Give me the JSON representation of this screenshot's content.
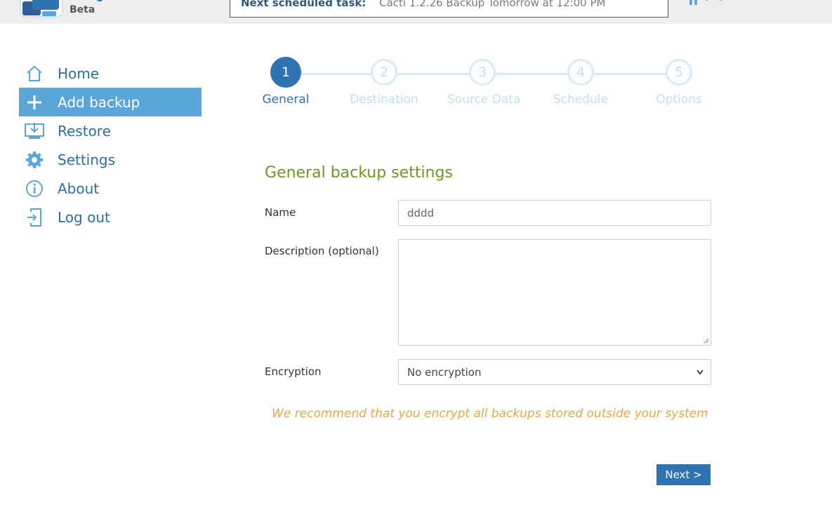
{
  "header": {
    "brand_beta": "Beta",
    "task_label": "Next scheduled task:",
    "task_value": "Cacti 1.2.26 Backup Tomorrow at 12:00 PM"
  },
  "colors": {
    "accent": "#2f73b3",
    "nav_active_bg": "#5aa6db",
    "section_title": "#6a9a1f",
    "warning": "#e8a64c",
    "step_inactive": "#bfdff2"
  },
  "sidebar": {
    "items": [
      {
        "label": "Home",
        "icon": "home-icon",
        "active": false
      },
      {
        "label": "Add backup",
        "icon": "plus-icon",
        "active": true
      },
      {
        "label": "Restore",
        "icon": "restore-icon",
        "active": false
      },
      {
        "label": "Settings",
        "icon": "gear-icon",
        "active": false
      },
      {
        "label": "About",
        "icon": "info-icon",
        "active": false
      },
      {
        "label": "Log out",
        "icon": "logout-icon",
        "active": false
      }
    ]
  },
  "stepper": {
    "steps": [
      {
        "number": "1",
        "label": "General",
        "active": true
      },
      {
        "number": "2",
        "label": "Destination",
        "active": false
      },
      {
        "number": "3",
        "label": "Source Data",
        "active": false
      },
      {
        "number": "4",
        "label": "Schedule",
        "active": false
      },
      {
        "number": "5",
        "label": "Options",
        "active": false
      }
    ]
  },
  "form": {
    "title": "General backup settings",
    "name_label": "Name",
    "name_value": "dddd",
    "description_label": "Description (optional)",
    "description_value": "",
    "encryption_label": "Encryption",
    "encryption_value": "No encryption",
    "warning": "We recommend that you encrypt all backups stored outside your system",
    "next_label": "Next >"
  }
}
